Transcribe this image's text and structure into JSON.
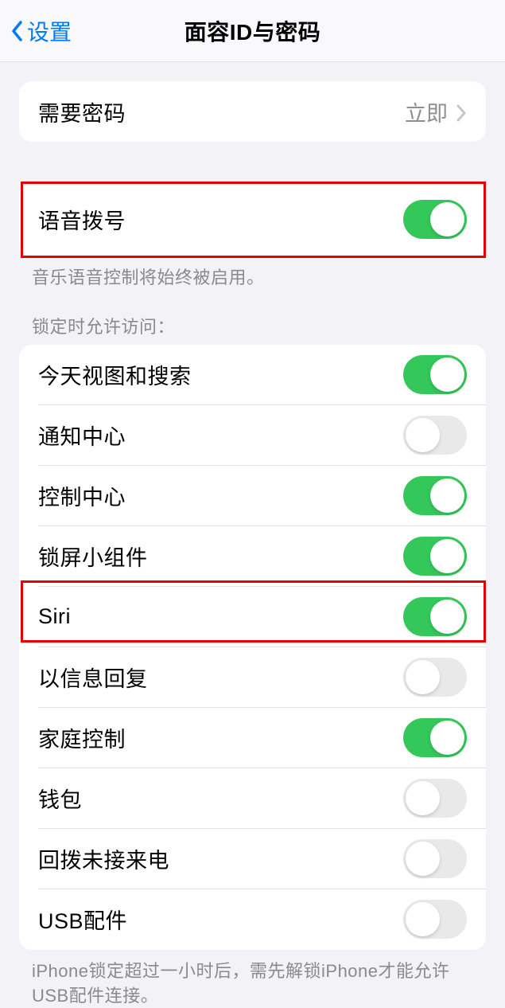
{
  "nav": {
    "back_label": "设置",
    "title": "面容ID与密码"
  },
  "group1": {
    "require_passcode": {
      "label": "需要密码",
      "value": "立即"
    }
  },
  "group2": {
    "voice_dial": {
      "label": "语音拨号",
      "on": true
    },
    "footer": "音乐语音控制将始终被启用。"
  },
  "group3": {
    "header": "锁定时允许访问：",
    "items": [
      {
        "label": "今天视图和搜索",
        "on": true
      },
      {
        "label": "通知中心",
        "on": false
      },
      {
        "label": "控制中心",
        "on": true
      },
      {
        "label": "锁屏小组件",
        "on": true
      },
      {
        "label": "Siri",
        "on": true
      },
      {
        "label": "以信息回复",
        "on": false
      },
      {
        "label": "家庭控制",
        "on": true
      },
      {
        "label": "钱包",
        "on": false
      },
      {
        "label": "回拨未接来电",
        "on": false
      },
      {
        "label": "USB配件",
        "on": false
      }
    ],
    "footer": "iPhone锁定超过一小时后，需先解锁iPhone才能允许USB配件连接。"
  }
}
